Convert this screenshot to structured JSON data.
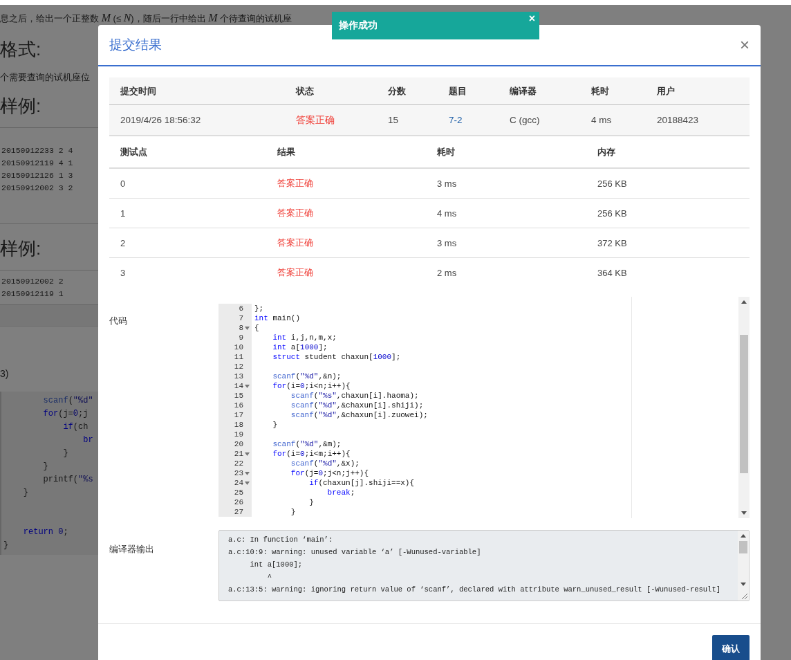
{
  "background_page": {
    "statement_lines": [
      "息之后，给出一个正整数 *M* (≤ *N*)，随后一行中给出 *M* 个待查询的试机座"
    ],
    "output_format_heading": "格式:",
    "output_format_text": "个需要查询的试机座位",
    "input_sample_heading": "样例:",
    "input_sample_lines": [
      "20150912233 2 4",
      "20150912119 4 1",
      "20150912126 1 3",
      "20150912002 3 2"
    ],
    "output_sample_heading": "样例:",
    "output_sample_lines": [
      "20150912002 2",
      "20150912119 1"
    ],
    "editor_caption": "3)",
    "code_lines": [
      {
        "kind": "code",
        "tokens": [
          {
            "kind": "fn",
            "text": "        scanf"
          },
          {
            "kind": "plain",
            "text": "("
          },
          {
            "kind": "str",
            "text": "\"%d\""
          }
        ]
      },
      {
        "kind": "code",
        "tokens": [
          {
            "kind": "kw",
            "text": "        for"
          },
          {
            "kind": "plain",
            "text": "(j="
          },
          {
            "kind": "num",
            "text": "0"
          },
          {
            "kind": "plain",
            "text": ";j"
          }
        ]
      },
      {
        "kind": "code",
        "tokens": [
          {
            "kind": "kw",
            "text": "            if"
          },
          {
            "kind": "plain",
            "text": "(ch"
          }
        ]
      },
      {
        "kind": "code",
        "tokens": [
          {
            "kind": "kw",
            "text": "                br"
          }
        ]
      },
      {
        "kind": "code",
        "tokens": [
          {
            "kind": "plain",
            "text": "            }"
          }
        ]
      },
      {
        "kind": "code",
        "tokens": [
          {
            "kind": "plain",
            "text": "        }"
          }
        ]
      },
      {
        "kind": "code",
        "tokens": [
          {
            "kind": "plain",
            "text": "        printf("
          },
          {
            "kind": "str",
            "text": "\"%s"
          }
        ]
      },
      {
        "kind": "code",
        "tokens": [
          {
            "kind": "plain",
            "text": "    }"
          }
        ]
      },
      {
        "kind": "blank"
      },
      {
        "kind": "blank"
      },
      {
        "kind": "code",
        "tokens": [
          {
            "kind": "kw",
            "text": "    return"
          },
          {
            "kind": "num",
            "text": " 0"
          },
          {
            "kind": "plain",
            "text": ";"
          }
        ]
      },
      {
        "kind": "code",
        "tokens": [
          {
            "kind": "plain",
            "text": "}"
          }
        ]
      }
    ]
  },
  "toast": {
    "message": "操作成功",
    "close": "×"
  },
  "dialog": {
    "title": "提交结果",
    "close": "×",
    "summary": {
      "columns": [
        "提交时间",
        "状态",
        "分数",
        "题目",
        "编译器",
        "耗时",
        "用户"
      ],
      "row": [
        {
          "kind": "text",
          "text": "2019/4/26 18:56:32"
        },
        {
          "kind": "status",
          "text": "答案正确"
        },
        {
          "kind": "text",
          "text": "15"
        },
        {
          "kind": "link",
          "text": "7-2"
        },
        {
          "kind": "text",
          "text": "C (gcc)"
        },
        {
          "kind": "text",
          "text": "4 ms"
        },
        {
          "kind": "text",
          "text": "20188423"
        }
      ]
    },
    "tests": {
      "columns": [
        "测试点",
        "结果",
        "耗时",
        "内存"
      ],
      "rows": [
        [
          "0",
          "答案正确",
          "3 ms",
          "256 KB"
        ],
        [
          "1",
          "答案正确",
          "4 ms",
          "256 KB"
        ],
        [
          "2",
          "答案正确",
          "3 ms",
          "372 KB"
        ],
        [
          "3",
          "答案正确",
          "2 ms",
          "364 KB"
        ]
      ]
    },
    "code_label": "代码",
    "code": [
      {
        "number": "6",
        "fold": false,
        "tokens": [
          {
            "kind": "plain",
            "text": "};"
          }
        ]
      },
      {
        "number": "7",
        "fold": false,
        "tokens": [
          {
            "kind": "kw",
            "text": "int"
          },
          {
            "kind": "plain",
            "text": " main()"
          }
        ]
      },
      {
        "number": "8",
        "fold": true,
        "tokens": [
          {
            "kind": "plain",
            "text": "{"
          }
        ]
      },
      {
        "number": "9",
        "fold": false,
        "tokens": [
          {
            "kind": "kw",
            "text": "    int"
          },
          {
            "kind": "plain",
            "text": " i,j,n,m,x;"
          }
        ]
      },
      {
        "number": "10",
        "fold": false,
        "tokens": [
          {
            "kind": "kw",
            "text": "    int"
          },
          {
            "kind": "plain",
            "text": " a["
          },
          {
            "kind": "num",
            "text": "1000"
          },
          {
            "kind": "plain",
            "text": "];"
          }
        ]
      },
      {
        "number": "11",
        "fold": false,
        "tokens": [
          {
            "kind": "kw",
            "text": "    struct"
          },
          {
            "kind": "plain",
            "text": " student chaxun["
          },
          {
            "kind": "num",
            "text": "1000"
          },
          {
            "kind": "plain",
            "text": "];"
          }
        ]
      },
      {
        "number": "12",
        "fold": false
      },
      {
        "number": "13",
        "fold": false,
        "tokens": [
          {
            "kind": "fn",
            "text": "    scanf"
          },
          {
            "kind": "plain",
            "text": "("
          },
          {
            "kind": "str",
            "text": "\"%d\""
          },
          {
            "kind": "plain",
            "text": ",&n);"
          }
        ]
      },
      {
        "number": "14",
        "fold": true,
        "tokens": [
          {
            "kind": "kw",
            "text": "    for"
          },
          {
            "kind": "plain",
            "text": "(i="
          },
          {
            "kind": "num",
            "text": "0"
          },
          {
            "kind": "plain",
            "text": ";i<n;i++){"
          }
        ]
      },
      {
        "number": "15",
        "fold": false,
        "tokens": [
          {
            "kind": "fn",
            "text": "        scanf"
          },
          {
            "kind": "plain",
            "text": "("
          },
          {
            "kind": "str",
            "text": "\"%s\""
          },
          {
            "kind": "plain",
            "text": ",chaxun[i].haoma);"
          }
        ]
      },
      {
        "number": "16",
        "fold": false,
        "tokens": [
          {
            "kind": "fn",
            "text": "        scanf"
          },
          {
            "kind": "plain",
            "text": "("
          },
          {
            "kind": "str",
            "text": "\"%d\""
          },
          {
            "kind": "plain",
            "text": ",&chaxun[i].shiji);"
          }
        ]
      },
      {
        "number": "17",
        "fold": false,
        "tokens": [
          {
            "kind": "fn",
            "text": "        scanf"
          },
          {
            "kind": "plain",
            "text": "("
          },
          {
            "kind": "str",
            "text": "\"%d\""
          },
          {
            "kind": "plain",
            "text": ",&chaxun[i].zuowei);"
          }
        ]
      },
      {
        "number": "18",
        "fold": false,
        "tokens": [
          {
            "kind": "plain",
            "text": "    }"
          }
        ]
      },
      {
        "number": "19",
        "fold": false
      },
      {
        "number": "20",
        "fold": false,
        "tokens": [
          {
            "kind": "fn",
            "text": "    scanf"
          },
          {
            "kind": "plain",
            "text": "("
          },
          {
            "kind": "str",
            "text": "\"%d\""
          },
          {
            "kind": "plain",
            "text": ",&m);"
          }
        ]
      },
      {
        "number": "21",
        "fold": true,
        "tokens": [
          {
            "kind": "kw",
            "text": "    for"
          },
          {
            "kind": "plain",
            "text": "(i="
          },
          {
            "kind": "num",
            "text": "0"
          },
          {
            "kind": "plain",
            "text": ";i<m;i++){"
          }
        ]
      },
      {
        "number": "22",
        "fold": false,
        "tokens": [
          {
            "kind": "fn",
            "text": "        scanf"
          },
          {
            "kind": "plain",
            "text": "("
          },
          {
            "kind": "str",
            "text": "\"%d\""
          },
          {
            "kind": "plain",
            "text": ",&x);"
          }
        ]
      },
      {
        "number": "23",
        "fold": true,
        "tokens": [
          {
            "kind": "kw",
            "text": "        for"
          },
          {
            "kind": "plain",
            "text": "(j="
          },
          {
            "kind": "num",
            "text": "0"
          },
          {
            "kind": "plain",
            "text": ";j<n;j++){"
          }
        ]
      },
      {
        "number": "24",
        "fold": true,
        "tokens": [
          {
            "kind": "kw",
            "text": "            if"
          },
          {
            "kind": "plain",
            "text": "(chaxun[j].shiji==x){"
          }
        ]
      },
      {
        "number": "25",
        "fold": false,
        "tokens": [
          {
            "kind": "kw",
            "text": "                break"
          },
          {
            "kind": "plain",
            "text": ";"
          }
        ]
      },
      {
        "number": "26",
        "fold": false,
        "tokens": [
          {
            "kind": "plain",
            "text": "            }"
          }
        ]
      },
      {
        "number": "27",
        "fold": false,
        "tokens": [
          {
            "kind": "plain",
            "text": "        }"
          }
        ]
      }
    ],
    "output_label": "编译器输出",
    "compiler_output": [
      "a.c: In function ‘main’:",
      "a.c:10:9: warning: unused variable ‘a’ [-Wunused-variable]",
      "     int a[1000];",
      "         ^",
      "a.c:13:5: warning: ignoring return value of ‘scanf’, declared with attribute warn_unused_result [-Wunused-result]"
    ],
    "confirm": "确认"
  }
}
